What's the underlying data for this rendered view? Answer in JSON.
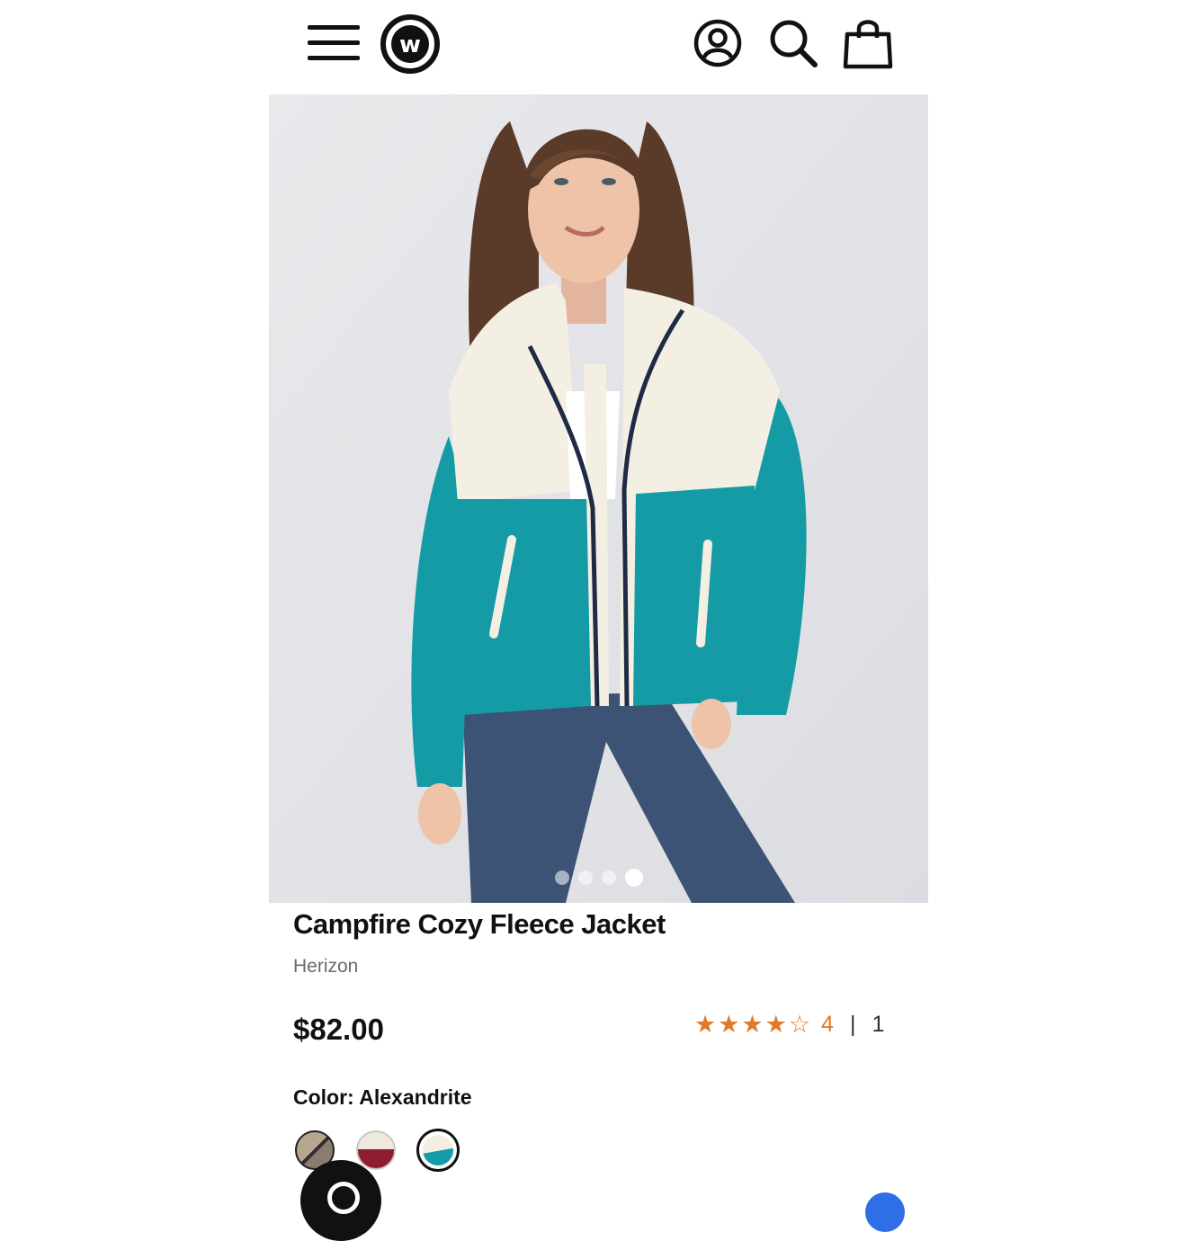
{
  "header": {
    "menu_icon": "hamburger-menu-icon",
    "logo_letter": "w",
    "account_icon": "user-account-icon",
    "search_icon": "search-icon",
    "bag_icon": "shopping-bag-icon"
  },
  "gallery": {
    "slide_count": 4,
    "active_index": 3
  },
  "product": {
    "title": "Campfire Cozy Fleece Jacket",
    "brand": "Herizon",
    "price": "$82.00",
    "rating": {
      "stars": "★★★★☆",
      "value": "4",
      "separator": "|",
      "reviews": "1"
    },
    "color_label": "Color:",
    "color_value": "Alexandrite",
    "swatches": [
      {
        "name": "taupe",
        "selected": false
      },
      {
        "name": "burgundy-cream",
        "selected": false
      },
      {
        "name": "alexandrite",
        "selected": true
      }
    ]
  },
  "colors": {
    "accent_star": "#e0792a",
    "jacket_teal": "#159ba5",
    "jacket_cream": "#f4efe3",
    "denim": "#3d5376"
  }
}
